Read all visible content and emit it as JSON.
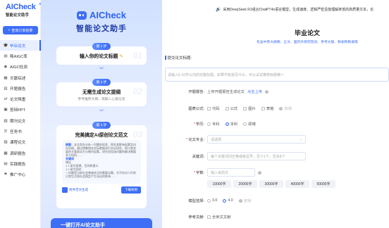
{
  "sidebar": {
    "logo_text": "AICheck",
    "logo_sub": "智能论文助手",
    "order_button": "查询订单结果",
    "items": [
      {
        "label": "毕业论文",
        "icon": "graduation-icon",
        "active": true
      },
      {
        "label": "降AIGC率",
        "icon": "chart-down-icon"
      },
      {
        "label": "AIGC检测",
        "icon": "scan-icon"
      },
      {
        "label": "文献综述",
        "icon": "doc-icon"
      },
      {
        "label": "开题报告",
        "icon": "report-icon"
      },
      {
        "label": "论文降重",
        "icon": "merge-icon"
      },
      {
        "label": "答辩PPT",
        "icon": "ppt-icon"
      },
      {
        "label": "期刊论文",
        "icon": "journal-icon"
      },
      {
        "label": "任务书",
        "icon": "task-icon"
      },
      {
        "label": "课程论文",
        "icon": "course-icon"
      },
      {
        "label": "调研报告",
        "icon": "research-icon"
      },
      {
        "label": "实践报告",
        "icon": "practice-icon"
      },
      {
        "label": "推广中心",
        "icon": "promote-icon"
      }
    ]
  },
  "promo": {
    "brand": "AICheck",
    "headline": "智能论文助手",
    "steps": [
      {
        "badge": "第 1 步",
        "title": "输入你的论文标题",
        "num": "01"
      },
      {
        "badge": "第 2 步",
        "title": "无需生成论文提纲",
        "desc": "参考推荐大纲，或输入心意信息",
        "num": "02"
      },
      {
        "badge": "第 3 步",
        "title": "完美搞定AI原创论文范文",
        "num": "03"
      }
    ],
    "doc_preview": {
      "abstract_label": "摘要：",
      "abstract_text": "本文首先分析一问题的现状，探究其影响因素及内在机理。通过搜集相关实际数据进行实证研究，探讨其发展的主要驱动力与制约因素。研究发现该问题的解决需要多方协同……",
      "keywords_label": "关键词",
      "outline_label": "绪论",
      "outline_items": [
        "1.1 研究背景、目的和意义",
        "1.2 研究现状"
      ],
      "outline_text": "一问题是当前社会普遍关注的重要议题。它不仅对人们的日常生活和社会稳定产生深远的影响……"
    },
    "example_link": "附件范文生成",
    "download_button": "下载样例",
    "bottom_banner": "一键打开AI论文助手"
  },
  "notice": {
    "text": "采用DeepSeek R1组合ChatPT4o语言模型，生成速度、逻辑严密且能理解率低的高质量文本，论"
  },
  "main": {
    "title": "毕业论文",
    "subtitle": "包含中英文摘要、正文、国内外研究现状、参考文献、致谢和致谢等",
    "title_field_label": "提交论文标题:",
    "title_placeholder": "请输入5-10字以内的完整标题，如果不知道写什么，可以试试推荐标题哦～",
    "proposal": {
      "label": "开题报告:",
      "text": "上传开题报告生成论文",
      "link": "点击上传"
    },
    "figures": {
      "label": "图表公式:",
      "options": [
        "代码",
        "公式",
        "图片",
        "表格"
      ],
      "extra": "获得"
    },
    "degree": {
      "label": "学历:",
      "options": [
        "专科",
        "本科",
        "硕博"
      ],
      "selected": "本科"
    },
    "major": {
      "label": "论文专业:",
      "placeholder": "请选择"
    },
    "keywords": {
      "label": "关键词:",
      "placeholder": "每个关键词间空格或者逗号，至少1个，至多8个"
    },
    "wordcount": {
      "label": "字数:",
      "placeholder": "输入目前文",
      "options": [
        "10000字",
        "20000字",
        "30000字",
        "40000字",
        "50000字"
      ]
    },
    "model": {
      "label": "模型选择:",
      "options": [
        "3.0",
        "4.0"
      ],
      "selected": "4.0",
      "extra": "获得"
    },
    "refs": {
      "label": "参考文献:",
      "option": "全英文文献"
    }
  }
}
